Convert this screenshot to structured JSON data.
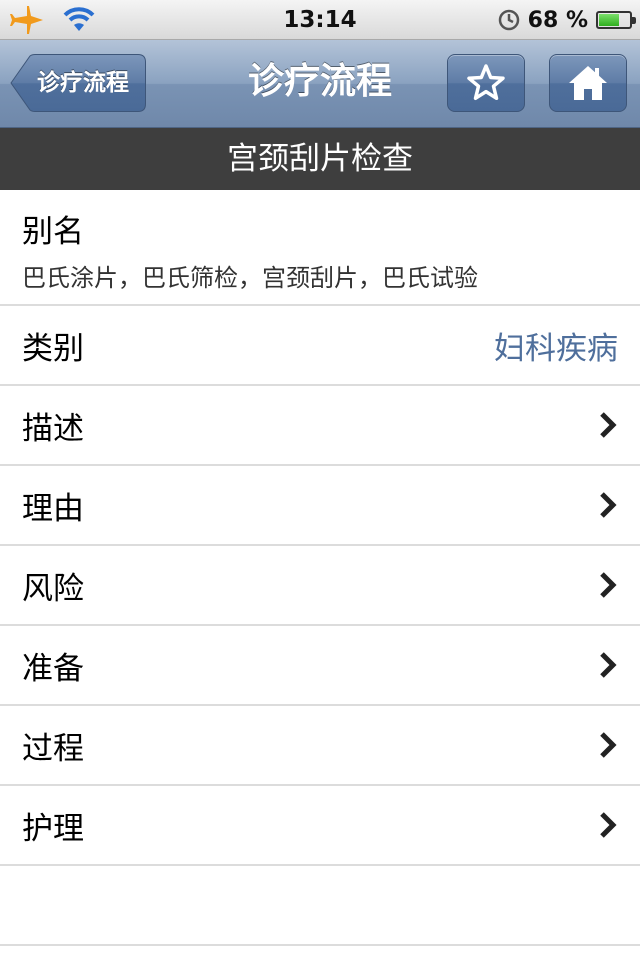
{
  "status_bar": {
    "time": "13:14",
    "battery_percent": "68 %",
    "battery_level": 0.68,
    "icons": [
      "airplane-icon",
      "wifi-icon",
      "alarm-clock-icon",
      "battery-icon"
    ],
    "airplane_color": "#f19a1c"
  },
  "nav": {
    "back_label": "诊疗流程",
    "title": "诊疗流程",
    "favorite_icon": "star-icon",
    "home_icon": "home-icon"
  },
  "section_header": "宫颈刮片检查",
  "alias": {
    "title": "别名",
    "text": "巴氏涂片，巴氏筛检，宫颈刮片，巴氏试验"
  },
  "category": {
    "label": "类别",
    "value": "妇科疾病",
    "value_color": "#4f6f9c"
  },
  "items": [
    {
      "label": "描述"
    },
    {
      "label": "理由"
    },
    {
      "label": "风险"
    },
    {
      "label": "准备"
    },
    {
      "label": "过程"
    },
    {
      "label": "护理"
    }
  ]
}
